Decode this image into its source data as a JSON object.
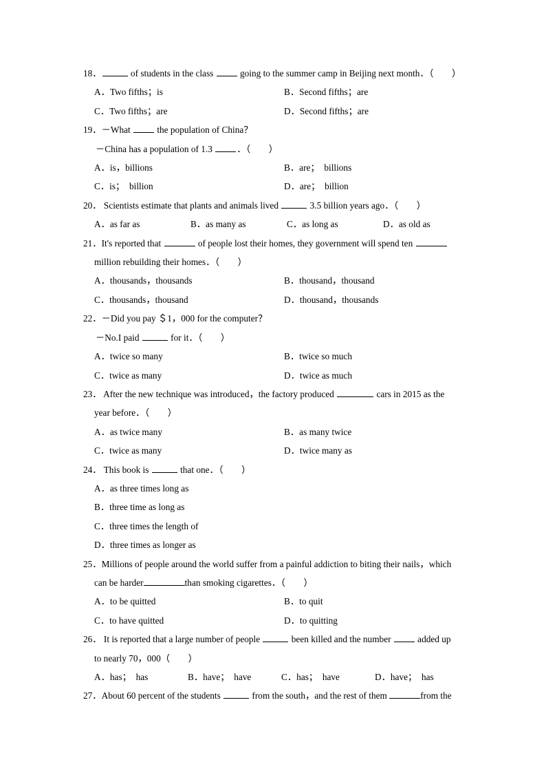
{
  "document": {
    "type": "english-grammar-multiple-choice-worksheet",
    "page_background": "#ffffff",
    "text_color": "#000000"
  },
  "questions": [
    {
      "number": "18．",
      "stem_prefix": "",
      "stem_parts": [
        {
          "blank": "b5"
        },
        {
          "text": " of students in the class "
        },
        {
          "blank": "b4"
        },
        {
          "text": " going to the summer camp in Beijing next month．（  ）"
        }
      ],
      "stem_plain": "18． _____ of students in the class ____ going to the summer camp in Beijing next month．（  ）",
      "layout": "two-column",
      "options": [
        {
          "label": "A．",
          "text": "Two fifths；is"
        },
        {
          "label": "B．",
          "text": "Second fifths；are"
        },
        {
          "label": "C．",
          "text": "Two fifths；are"
        },
        {
          "label": "D．",
          "text": "Second fifths；are"
        }
      ]
    },
    {
      "number": "19．",
      "dialog_line1": "－What ____ the population of China？",
      "dialog_line2": "－China has a population of 1.3 ____．（  ）",
      "layout": "two-column",
      "options": [
        {
          "label": "A．",
          "text": "is，billions"
        },
        {
          "label": "B．",
          "text": "are； billions"
        },
        {
          "label": "C．",
          "text": "is； billion"
        },
        {
          "label": "D．",
          "text": "are； billion"
        }
      ]
    },
    {
      "number": "20．",
      "stem_plain": "20． Scientists estimate that plants and animals lived _____ 3.5 billion years ago．（  ）",
      "layout": "four-inline",
      "options": [
        {
          "label": "A．",
          "text": "as far as"
        },
        {
          "label": "B．",
          "text": "as many as"
        },
        {
          "label": "C．",
          "text": "as long as"
        },
        {
          "label": "D．",
          "text": "as old as"
        }
      ]
    },
    {
      "number": "21．",
      "stem_plain": "21．It's reported that ______ of people lost their homes, they government will spend ten ______",
      "continuation": "million rebuilding their homes．（  ）",
      "layout": "two-column",
      "options": [
        {
          "label": "A．",
          "text": "thousands，thousands"
        },
        {
          "label": "B．",
          "text": "thousand，thousand"
        },
        {
          "label": "C．",
          "text": "thousands，thousand"
        },
        {
          "label": "D．",
          "text": "thousand，thousands"
        }
      ]
    },
    {
      "number": "22．",
      "dialog_line1": "－Did you pay ＄1，000 for the computer？",
      "dialog_line2": "－No.I paid _____ for it．（  ）",
      "layout": "two-column",
      "options": [
        {
          "label": "A．",
          "text": "twice so many"
        },
        {
          "label": "B．",
          "text": "twice so much"
        },
        {
          "label": "C．",
          "text": "twice as many"
        },
        {
          "label": "D．",
          "text": "twice as much"
        }
      ]
    },
    {
      "number": "23．",
      "stem_plain": "23． After the new technique was introduced，the factory produced _______ cars in 2015 as the",
      "continuation": "year before．（  ）",
      "layout": "two-column",
      "options": [
        {
          "label": "A．",
          "text": "as twice many"
        },
        {
          "label": "B．",
          "text": "as many twice"
        },
        {
          "label": "C．",
          "text": "twice as many"
        },
        {
          "label": "D．",
          "text": "twice many as"
        }
      ]
    },
    {
      "number": "24．",
      "stem_plain": "24． This book is _____ that one．（  ）",
      "layout": "stacked",
      "options": [
        {
          "label": "A．",
          "text": "as three times long as"
        },
        {
          "label": "B．",
          "text": "three time as long as"
        },
        {
          "label": "C．",
          "text": "three times the length of"
        },
        {
          "label": "D．",
          "text": "three times as longer as"
        }
      ]
    },
    {
      "number": "25．",
      "stem_plain": "25．Millions of people around the world suffer from a painful addiction to biting their nails，which",
      "continuation": "can be harder________than smoking cigarettes．（  ）",
      "layout": "two-column",
      "options": [
        {
          "label": "A．",
          "text": "to be quitted"
        },
        {
          "label": "B．",
          "text": "to quit"
        },
        {
          "label": "C．",
          "text": "to have quitted"
        },
        {
          "label": "D．",
          "text": "to quitting"
        }
      ]
    },
    {
      "number": "26．",
      "stem_plain": "26． It is reported that a large number of people _____ been killed and the number ____ added up",
      "continuation": "to nearly 70，000（  ）",
      "layout": "four-inline",
      "options": [
        {
          "label": "A．",
          "text": "has； has"
        },
        {
          "label": "B．",
          "text": "have； have"
        },
        {
          "label": "C．",
          "text": "has； have"
        },
        {
          "label": "D．",
          "text": "have； has"
        }
      ]
    },
    {
      "number": "27．",
      "stem_plain": "27．About 60 percent of the students ______ from the south，and the rest of them ______from the",
      "layout": "truncated",
      "options": []
    }
  ],
  "text": {
    "q18": {
      "num": "18．",
      "seg1": " of students in the class ",
      "seg2": " going to the summer camp in Beijing next month．",
      "paren": "（  ）",
      "optA_label": "A．",
      "optA": "Two fifths；is",
      "optB_label": "B．",
      "optB": "Second fifths；are",
      "optC_label": "C．",
      "optC": "Two fifths；are",
      "optD_label": "D．",
      "optD": "Second fifths；are"
    },
    "q19": {
      "num": "19．",
      "line1a": "－What ",
      "line1b": " the population of China？",
      "line2a": "－China has a population of 1.3 ",
      "line2b": "．",
      "paren": "（  ）",
      "optA_label": "A．",
      "optA": "is，billions",
      "optB_label": "B．",
      "optB": "are； billions",
      "optC_label": "C．",
      "optC": "is； billion",
      "optD_label": "D．",
      "optD": "are； billion"
    },
    "q20": {
      "num": "20．",
      "seg1": " Scientists estimate that plants and animals lived ",
      "seg2": " 3.5 billion years ago．",
      "paren": "（  ）",
      "optA_label": "A．",
      "optA": "as far as",
      "optB_label": "B．",
      "optB": "as many as",
      "optC_label": "C．",
      "optC": "as long as",
      "optD_label": "D．",
      "optD": "as old as"
    },
    "q21": {
      "num": "21．",
      "seg1": "It's reported that ",
      "seg2": " of people lost their homes, they government will spend ten ",
      "cont": "million rebuilding their homes．",
      "paren": "（  ）",
      "optA_label": "A．",
      "optA": "thousands，thousands",
      "optB_label": "B．",
      "optB": "thousand，thousand",
      "optC_label": "C．",
      "optC": "thousands，thousand",
      "optD_label": "D．",
      "optD": "thousand，thousands"
    },
    "q22": {
      "num": "22．",
      "line1": "－Did you pay ＄1，000 for the computer？",
      "line2a": "－No.I paid ",
      "line2b": " for it．",
      "paren": "（  ）",
      "optA_label": "A．",
      "optA": "twice so many",
      "optB_label": "B．",
      "optB": "twice so much",
      "optC_label": "C．",
      "optC": "twice as many",
      "optD_label": "D．",
      "optD": "twice as much"
    },
    "q23": {
      "num": "23．",
      "seg1": " After the new technique was introduced，the factory produced ",
      "seg2": " cars in 2015 as the",
      "cont": "year before．",
      "paren": "（  ）",
      "optA_label": "A．",
      "optA": "as twice many",
      "optB_label": "B．",
      "optB": "as many twice",
      "optC_label": "C．",
      "optC": "twice as many",
      "optD_label": "D．",
      "optD": "twice many as"
    },
    "q24": {
      "num": "24．",
      "seg1": " This book is ",
      "seg2": " that one．",
      "paren": "（  ）",
      "optA_label": "A．",
      "optA": "as three times long as",
      "optB_label": "B．",
      "optB": "three time as long as",
      "optC_label": "C．",
      "optC": "three times the length of",
      "optD_label": "D．",
      "optD": "three times as longer as"
    },
    "q25": {
      "num": "25．",
      "seg1": "Millions of people around the world suffer from a painful addiction to biting their nails，which",
      "cont1": "can be harder",
      "cont2": "than smoking cigarettes．",
      "paren": "（  ）",
      "optA_label": "A．",
      "optA": "to be quitted",
      "optB_label": "B．",
      "optB": "to quit",
      "optC_label": "C．",
      "optC": "to have quitted",
      "optD_label": "D．",
      "optD": "to quitting"
    },
    "q26": {
      "num": "26．",
      "seg1": " It is reported that a large number of people ",
      "seg2": " been killed and the number ",
      "seg3": " added up",
      "cont": "to nearly 70，000",
      "paren": "（  ）",
      "optA_label": "A．",
      "optA": "has； has",
      "optB_label": "B．",
      "optB": "have； have",
      "optC_label": "C．",
      "optC": "has； have",
      "optD_label": "D．",
      "optD": "have； has"
    },
    "q27": {
      "num": "27．",
      "seg1": "About 60 percent of the students ",
      "seg2": " from the south，and the rest of them ",
      "seg3": "from the"
    }
  }
}
